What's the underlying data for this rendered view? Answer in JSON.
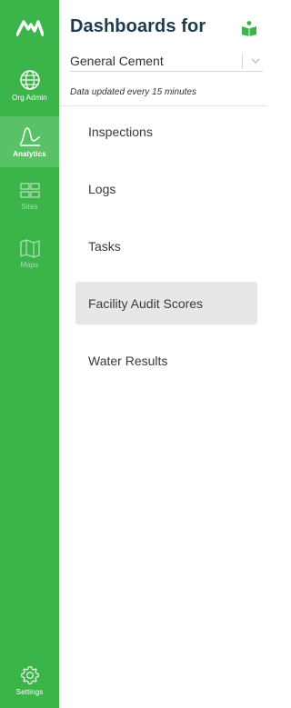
{
  "nav": {
    "items": [
      {
        "label": "Org Admin",
        "icon": "globe-icon",
        "state": "normal"
      },
      {
        "label": "Analytics",
        "icon": "analytics-icon",
        "state": "active"
      },
      {
        "label": "Sites",
        "icon": "sites-icon",
        "state": "muted"
      },
      {
        "label": "Maps",
        "icon": "map-icon",
        "state": "muted"
      }
    ],
    "settings_label": "Settings"
  },
  "header": {
    "title": "Dashboards for",
    "title_icon": "book-icon"
  },
  "site_select": {
    "value": "General Cement"
  },
  "update_note": "Data updated every 15 minutes",
  "dashboards": [
    {
      "label": "Inspections",
      "selected": false
    },
    {
      "label": "Logs",
      "selected": false
    },
    {
      "label": "Tasks",
      "selected": false
    },
    {
      "label": "Facility Audit Scores",
      "selected": true
    },
    {
      "label": "Water Results",
      "selected": false
    }
  ],
  "colors": {
    "rail": "#3bb54a",
    "rail_active": "#5ac266",
    "title": "#1f3b4d",
    "selected_bg": "#e6e7e9"
  }
}
